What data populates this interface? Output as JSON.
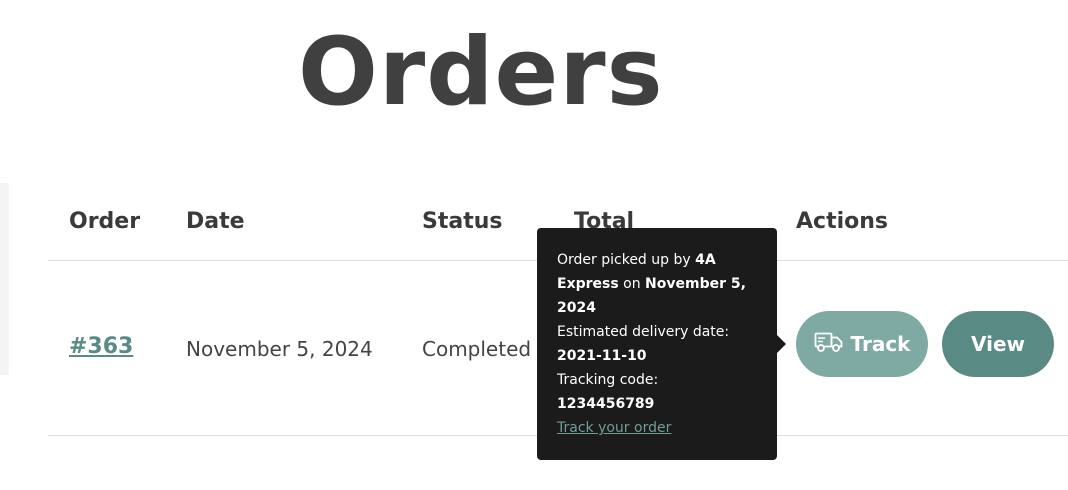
{
  "page_title": "Orders",
  "table": {
    "headers": {
      "order": "Order",
      "date": "Date",
      "status": "Status",
      "total": "Total",
      "actions": "Actions"
    },
    "rows": [
      {
        "order": "#363",
        "date": "November 5, 2024",
        "status": "Completed",
        "actions": {
          "track_label": "Track",
          "track_icon": "truck-icon",
          "view_label": "View"
        }
      }
    ]
  },
  "tooltip": {
    "picked_up_prefix": "Order picked up by ",
    "carrier": "4A Express",
    "on_text": " on ",
    "pickup_date": "November 5, 2024",
    "estimated_label": "Estimated delivery date:",
    "estimated_date": "2021-11-10",
    "tracking_label": "Tracking code:",
    "tracking_code": "1234456789",
    "link_text": "Track your order"
  },
  "colors": {
    "accent": "#5a8a84",
    "accent_light": "#7fa9a3",
    "tooltip_bg": "#1b1b1b",
    "title": "#404040"
  }
}
